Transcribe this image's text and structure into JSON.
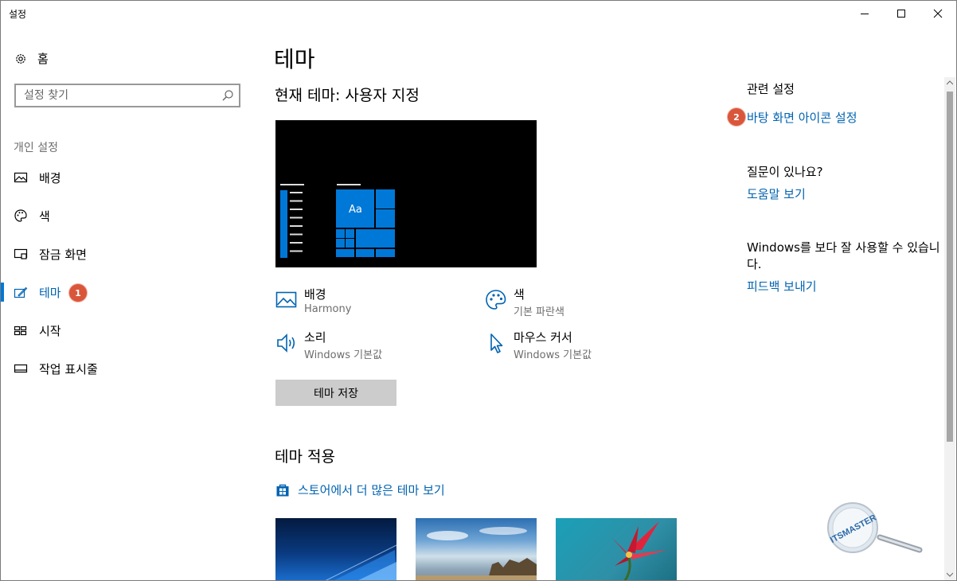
{
  "window": {
    "title": "설정"
  },
  "sidebar": {
    "home_label": "홈",
    "search_placeholder": "설정 찾기",
    "section_label": "개인 설정",
    "items": [
      {
        "label": "배경",
        "icon": "picture-icon"
      },
      {
        "label": "색",
        "icon": "palette-icon"
      },
      {
        "label": "잠금 화면",
        "icon": "lock-screen-icon"
      },
      {
        "label": "테마",
        "icon": "theme-brush-icon",
        "active": true,
        "badge": "1"
      },
      {
        "label": "시작",
        "icon": "start-grid-icon"
      },
      {
        "label": "작업 표시줄",
        "icon": "taskbar-icon"
      }
    ]
  },
  "main": {
    "title": "테마",
    "current_theme_label": "현재 테마: 사용자 지정",
    "preview_tile_text": "Aa",
    "props": [
      {
        "title": "배경",
        "value": "Harmony",
        "icon": "picture-icon"
      },
      {
        "title": "색",
        "value": "기본 파란색",
        "icon": "palette-icon"
      },
      {
        "title": "소리",
        "value": "Windows 기본값",
        "icon": "speaker-icon"
      },
      {
        "title": "마우스 커서",
        "value": "Windows 기본값",
        "icon": "cursor-icon"
      }
    ],
    "save_button": "테마 저장",
    "apply_title": "테마 적용",
    "store_link": "스토어에서 더 많은 테마 보기"
  },
  "related": {
    "heading": "관련 설정",
    "link": "바탕 화면 아이콘 설정",
    "badge": "2",
    "question": "질문이 있나요?",
    "help_link": "도움말 보기",
    "improve_text": "Windows를 보다 잘 사용할 수 있습니다.",
    "feedback_link": "피드백 보내기"
  },
  "watermark": {
    "text": "ITSMASTER"
  },
  "colors": {
    "accent": "#0078d7",
    "link": "#0063b1",
    "badge": "#d9563a"
  }
}
